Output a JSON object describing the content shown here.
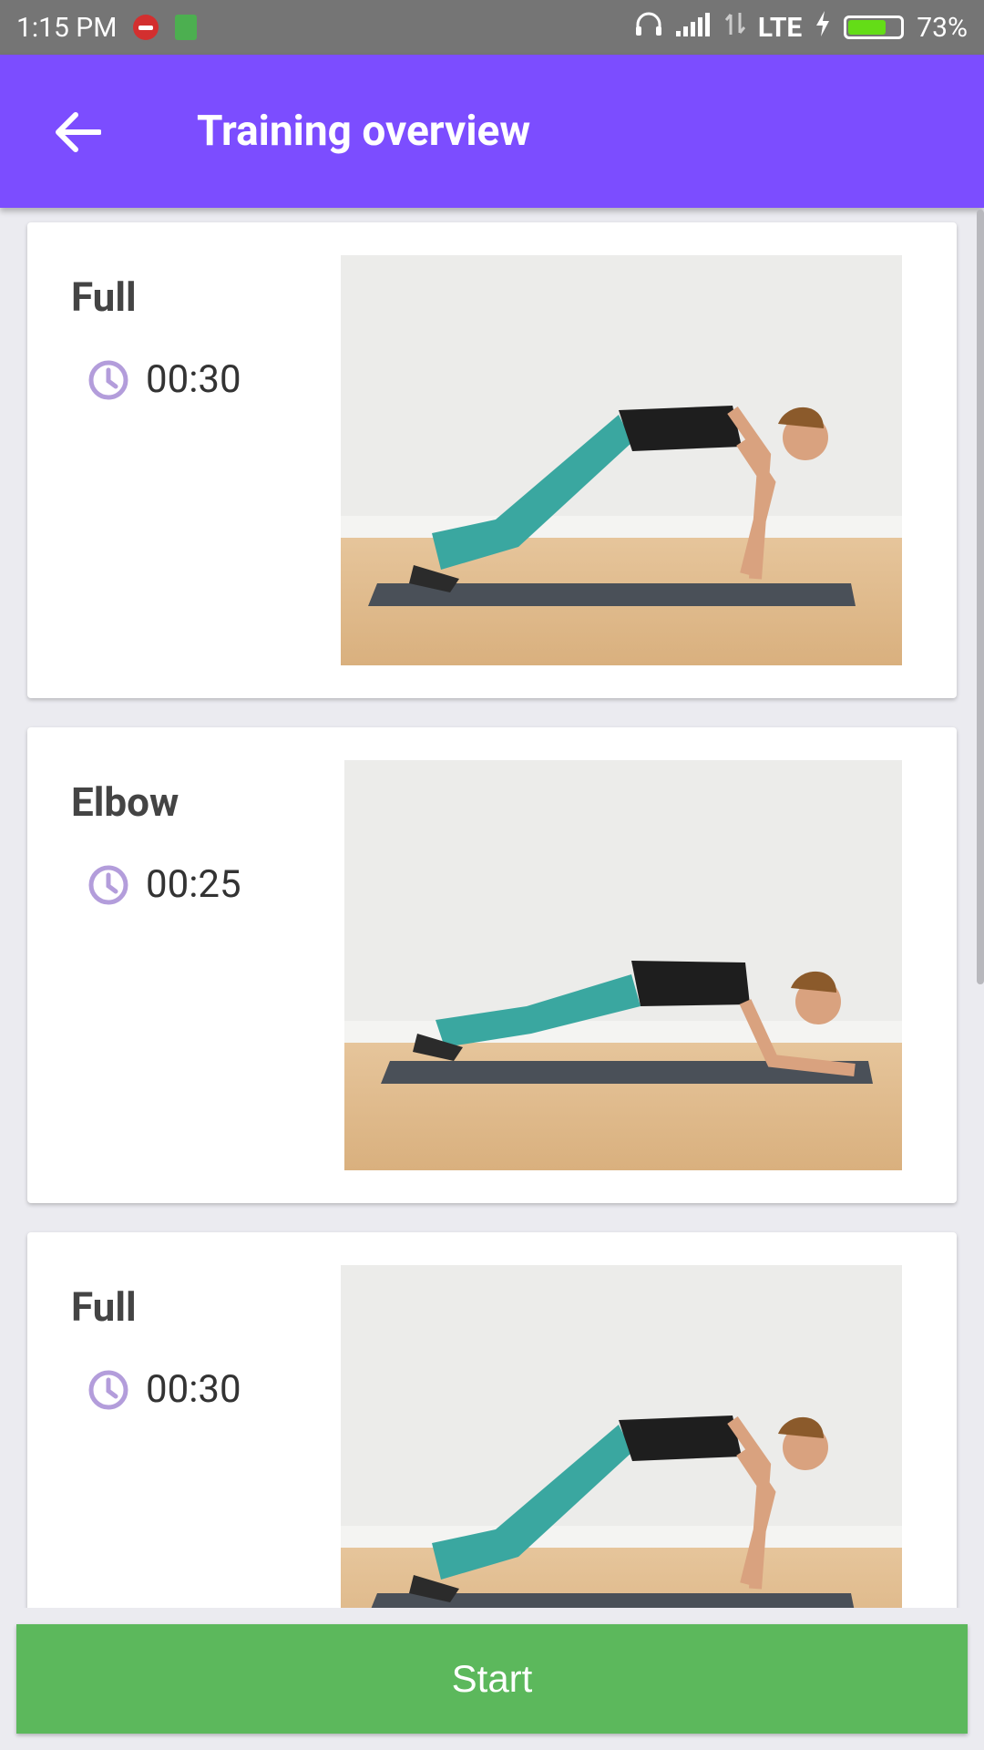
{
  "status_bar": {
    "time": "1:15 PM",
    "network": "LTE",
    "battery": "73%",
    "battery_level": 0.73
  },
  "app_bar": {
    "title": "Training overview"
  },
  "exercises": [
    {
      "name": "Full",
      "duration": "00:30"
    },
    {
      "name": "Elbow",
      "duration": "00:25"
    },
    {
      "name": "Full",
      "duration": "00:30"
    }
  ],
  "start_button": {
    "label": "Start"
  },
  "colors": {
    "primary": "#7c4dff",
    "accent_clock": "#b39ddb",
    "start": "#5cb85c"
  },
  "icons": {
    "back": "arrow-left-icon",
    "clock": "clock-icon"
  }
}
